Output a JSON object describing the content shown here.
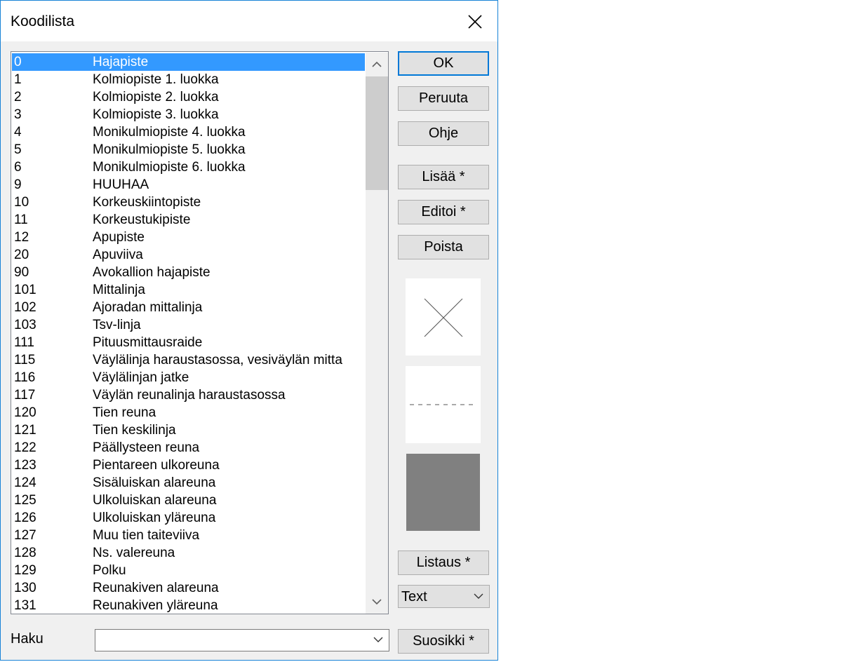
{
  "window": {
    "title": "Koodilista"
  },
  "list": {
    "rows": [
      {
        "code": "0",
        "name": "Hajapiste"
      },
      {
        "code": "1",
        "name": "Kolmiopiste 1. luokka"
      },
      {
        "code": "2",
        "name": "Kolmiopiste 2. luokka"
      },
      {
        "code": "3",
        "name": "Kolmiopiste 3. luokka"
      },
      {
        "code": "4",
        "name": "Monikulmiopiste 4. luokka"
      },
      {
        "code": "5",
        "name": "Monikulmiopiste 5. luokka"
      },
      {
        "code": "6",
        "name": "Monikulmiopiste 6. luokka"
      },
      {
        "code": "9",
        "name": "HUUHAA"
      },
      {
        "code": "10",
        "name": "Korkeuskiintopiste"
      },
      {
        "code": "11",
        "name": "Korkeustukipiste"
      },
      {
        "code": "12",
        "name": "Apupiste"
      },
      {
        "code": "20",
        "name": "Apuviiva"
      },
      {
        "code": "90",
        "name": "Avokallion hajapiste"
      },
      {
        "code": "101",
        "name": "Mittalinja"
      },
      {
        "code": "102",
        "name": "Ajoradan mittalinja"
      },
      {
        "code": "103",
        "name": "Tsv-linja"
      },
      {
        "code": "111",
        "name": "Pituusmittausraide"
      },
      {
        "code": "115",
        "name": "Väylälinja haraustasossa, vesiväylän mitta"
      },
      {
        "code": "116",
        "name": "Väylälinjan jatke"
      },
      {
        "code": "117",
        "name": "Väylän reunalinja haraustasossa"
      },
      {
        "code": "120",
        "name": "Tien reuna"
      },
      {
        "code": "121",
        "name": "Tien keskilinja"
      },
      {
        "code": "122",
        "name": "Päällysteen reuna"
      },
      {
        "code": "123",
        "name": "Pientareen ulkoreuna"
      },
      {
        "code": "124",
        "name": "Sisäluiskan alareuna"
      },
      {
        "code": "125",
        "name": "Ulkoluiskan alareuna"
      },
      {
        "code": "126",
        "name": "Ulkoluiskan yläreuna"
      },
      {
        "code": "127",
        "name": "Muu tien taiteviiva"
      },
      {
        "code": "128",
        "name": "Ns. valereuna"
      },
      {
        "code": "129",
        "name": "Polku"
      },
      {
        "code": "130",
        "name": "Reunakiven alareuna"
      },
      {
        "code": "131",
        "name": "Reunakiven yläreuna"
      }
    ],
    "selected_index": 0
  },
  "buttons": {
    "ok": "OK",
    "cancel": "Peruuta",
    "help": "Ohje",
    "add": "Lisää *",
    "edit": "Editoi *",
    "delete": "Poista",
    "listing": "Listaus *",
    "favorite": "Suosikki *"
  },
  "format_select": {
    "value": "Text"
  },
  "search": {
    "label": "Haku",
    "value": ""
  },
  "colors": {
    "selection": "#3399ff",
    "fill_preview": "#808080",
    "window_border": "#1883d7"
  },
  "icons": {
    "close": "close-icon",
    "scroll_up": "chevron-up-icon",
    "scroll_down": "chevron-down-icon",
    "dropdown": "chevron-down-icon"
  }
}
